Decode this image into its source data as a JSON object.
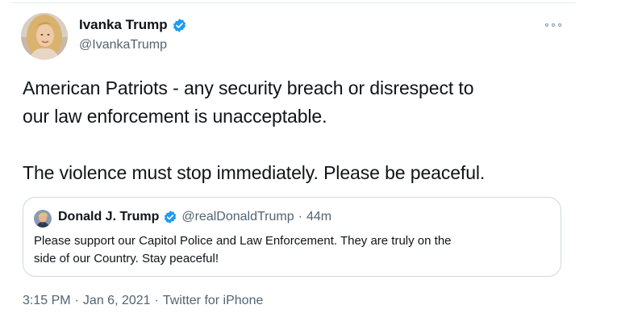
{
  "tweet": {
    "author": {
      "name": "Ivanka Trump",
      "handle": "@IvankaTrump",
      "verified": true,
      "avatar_icon": "profile-photo"
    },
    "more_icon": "more-options-icon",
    "text_lines": [
      "American Patriots - any security breach or disrespect to",
      "our law enforcement is unacceptable.",
      "",
      "The violence must stop immediately. Please be peaceful."
    ],
    "quoted": {
      "name": "Donald J. Trump",
      "handle": "@realDonaldTrump",
      "separator": "·",
      "time": "44m",
      "verified": true,
      "text_lines": [
        "Please support our Capitol Police and Law Enforcement. They are truly on the",
        "side of our Country. Stay peaceful!"
      ]
    },
    "meta": {
      "time": "3:15 PM",
      "separator1": "·",
      "date": "Jan 6, 2021",
      "separator2": "·",
      "source": "Twitter for iPhone"
    }
  },
  "colors": {
    "verified_blue": "#1d9bf0",
    "secondary_text": "#536471",
    "border": "#cfd9de"
  }
}
